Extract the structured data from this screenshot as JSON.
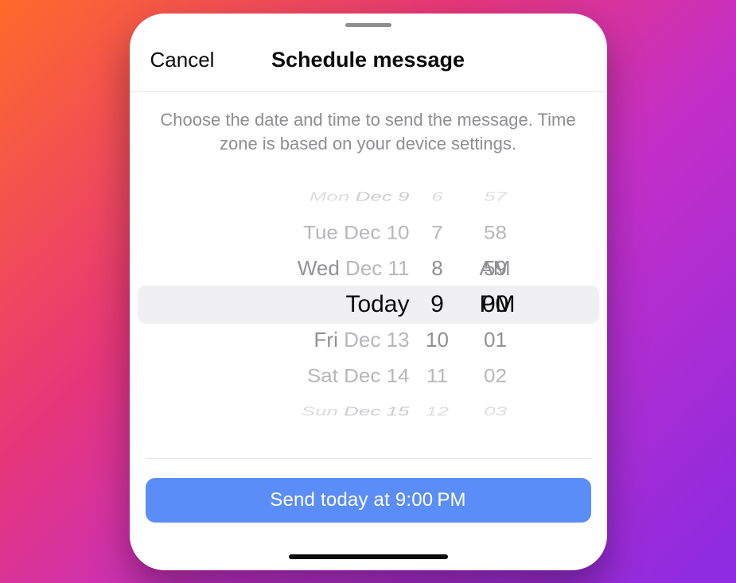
{
  "header": {
    "cancel_label": "Cancel",
    "title": "Schedule message"
  },
  "subtitle": "Choose the date and time to send the message. Time zone is based on your device settings.",
  "picker": {
    "rows": [
      {
        "wk": "Mon",
        "dt": "Dec 9",
        "hr": "6",
        "min": "57",
        "ampm": ""
      },
      {
        "wk": "Tue",
        "dt": "Dec 10",
        "hr": "7",
        "min": "58",
        "ampm": ""
      },
      {
        "wk": "Wed",
        "dt": "Dec 11",
        "hr": "8",
        "min": "59",
        "ampm": "AM"
      },
      {
        "wk": "",
        "dt": "Today",
        "hr": "9",
        "min": "00",
        "ampm": "PM"
      },
      {
        "wk": "Fri",
        "dt": "Dec 13",
        "hr": "10",
        "min": "01",
        "ampm": ""
      },
      {
        "wk": "Sat",
        "dt": "Dec 14",
        "hr": "11",
        "min": "02",
        "ampm": ""
      },
      {
        "wk": "Sun",
        "dt": "Dec 15",
        "hr": "12",
        "min": "03",
        "ampm": ""
      }
    ]
  },
  "send_button_label": "Send today at 9:00 PM"
}
